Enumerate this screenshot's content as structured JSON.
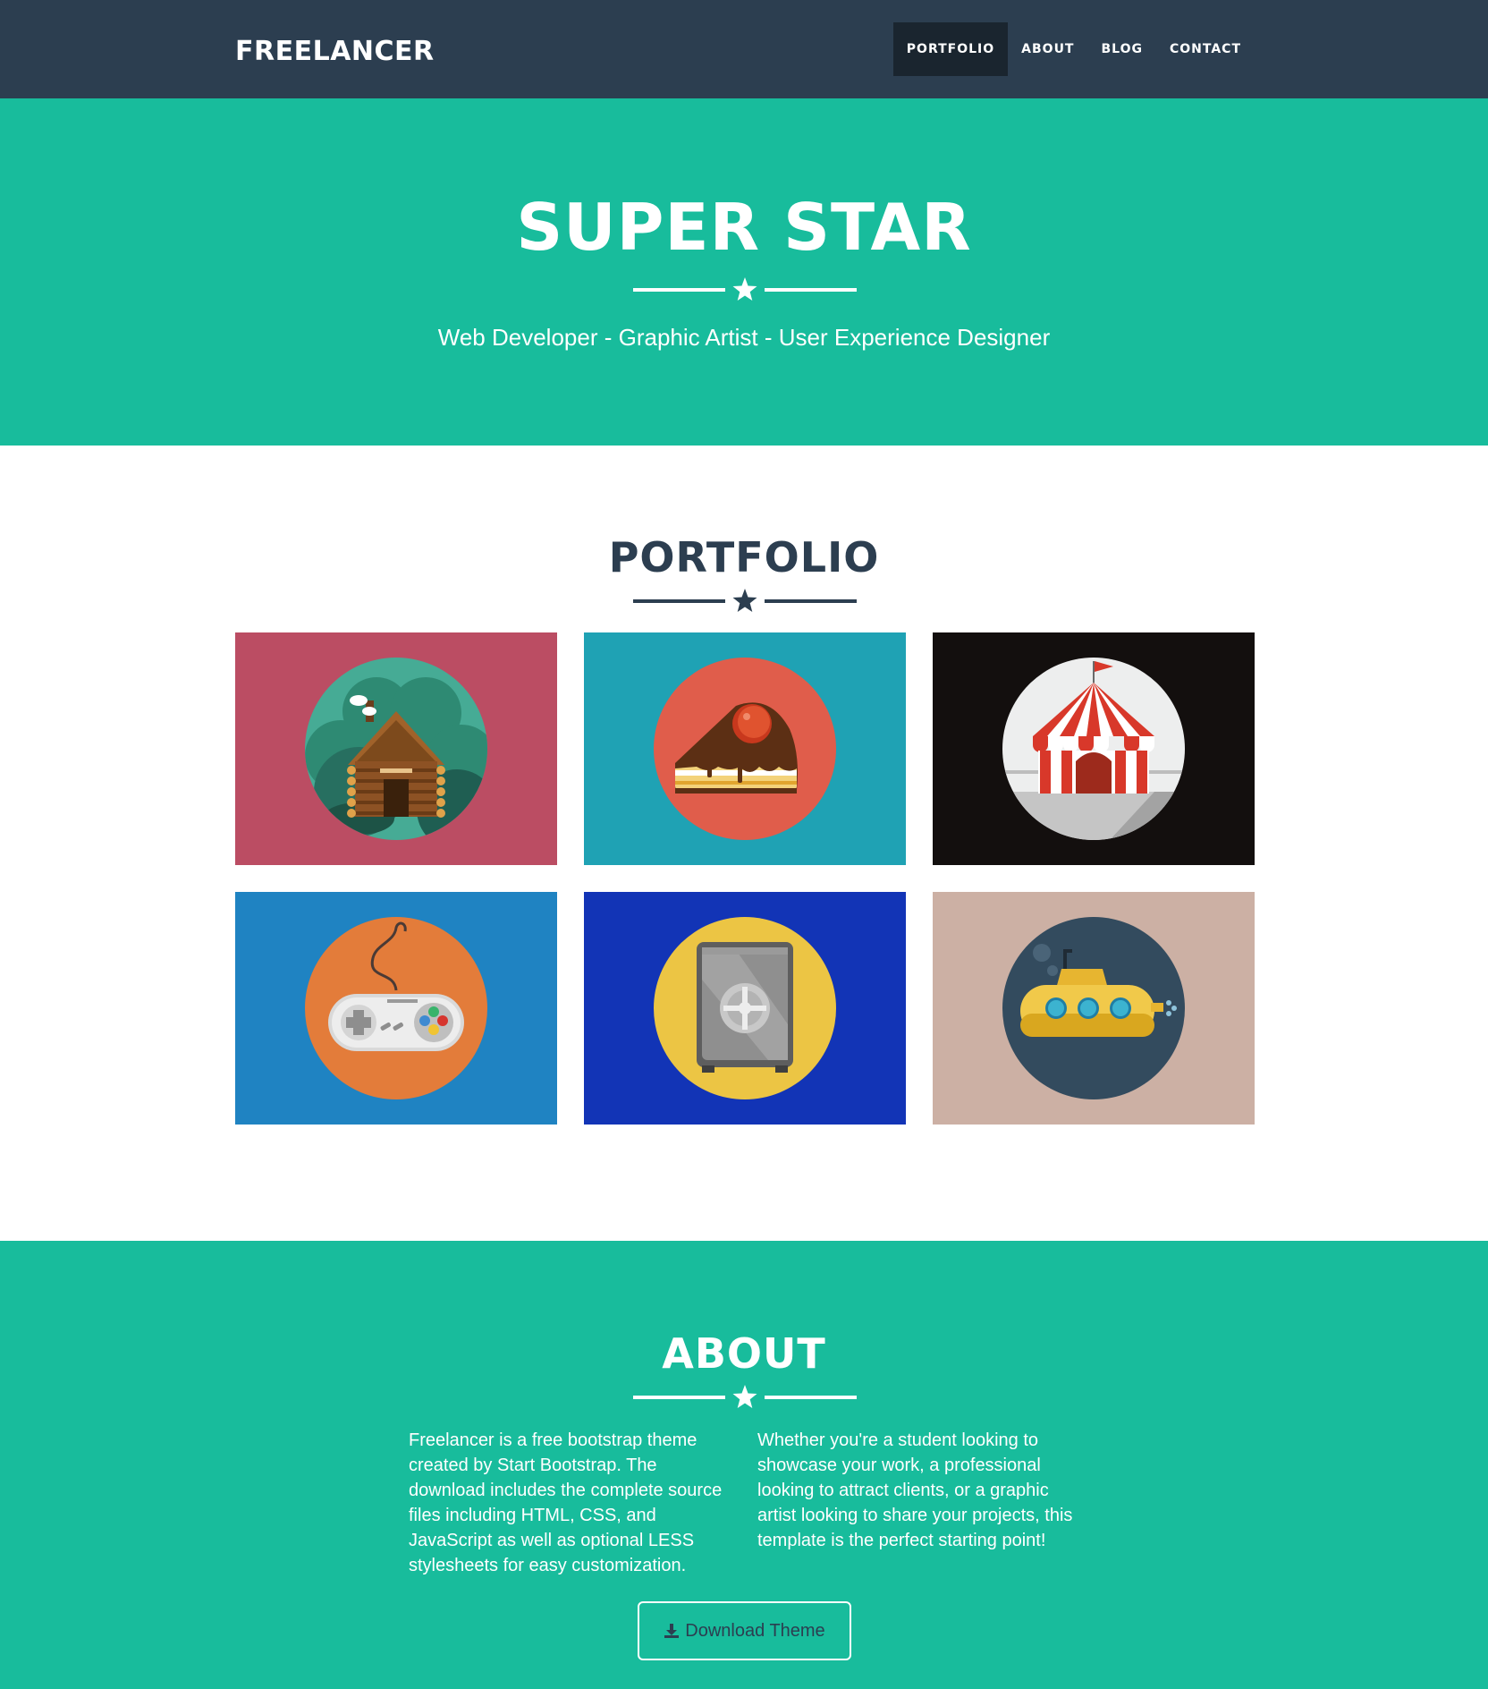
{
  "colors": {
    "nav_bg": "#2c3e50",
    "nav_active_bg": "#1a252f",
    "accent": "#18bc9c",
    "dark": "#2c3e50",
    "white": "#ffffff"
  },
  "nav": {
    "brand": "FREELANCER",
    "links": [
      {
        "label": "PORTFOLIO",
        "active": true
      },
      {
        "label": "ABOUT",
        "active": false
      },
      {
        "label": "BLOG",
        "active": false
      },
      {
        "label": "CONTACT",
        "active": false
      }
    ]
  },
  "hero": {
    "title": "SUPER STAR",
    "subtitle": "Web Developer - Graphic Artist - User Experience Designer"
  },
  "portfolio": {
    "title": "PORTFOLIO",
    "items": [
      {
        "icon": "cabin-icon",
        "bg": "#bb4d63",
        "circle": "#46ab95"
      },
      {
        "icon": "cake-icon",
        "bg": "#1fa2b4",
        "circle": "#e05d4b"
      },
      {
        "icon": "circus-tent-icon",
        "bg": "#130f0e",
        "circle": "#edeeee"
      },
      {
        "icon": "game-controller-icon",
        "bg": "#1f83c2",
        "circle": "#e37c3a"
      },
      {
        "icon": "safe-icon",
        "bg": "#1234b6",
        "circle": "#ecc544"
      },
      {
        "icon": "submarine-icon",
        "bg": "#ccb0a4",
        "circle": "#334b5e"
      }
    ]
  },
  "about": {
    "title": "ABOUT",
    "col_left": "Freelancer is a free bootstrap theme created by Start Bootstrap. The download includes the complete source files including HTML, CSS, and JavaScript as well as optional LESS stylesheets for easy customization.",
    "col_right": "Whether you're a student looking to showcase your work, a professional looking to attract clients, or a graphic artist looking to share your projects, this template is the perfect starting point!",
    "button_label": "Download Theme",
    "button_icon": "download-icon"
  }
}
